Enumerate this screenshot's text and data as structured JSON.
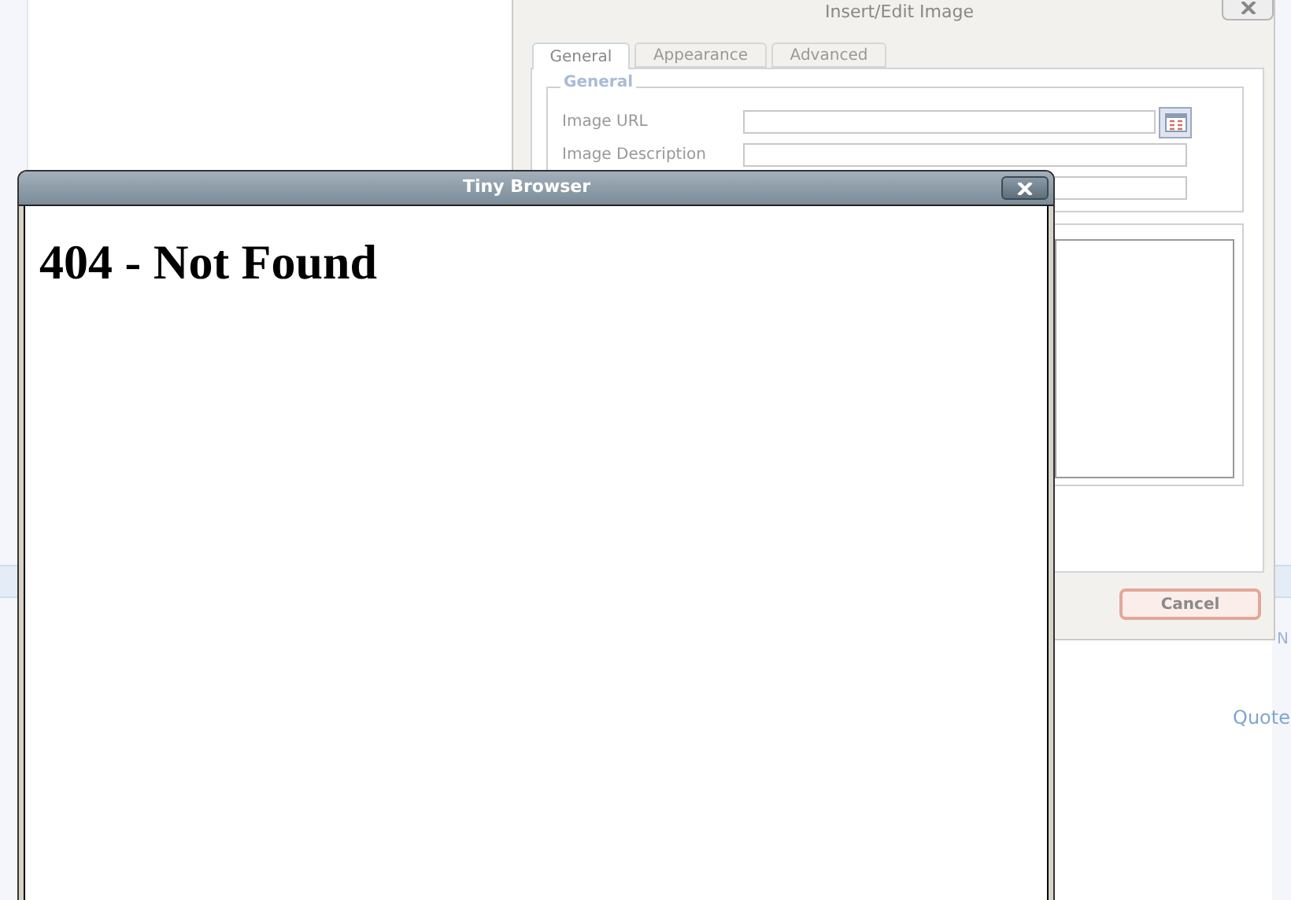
{
  "background_page": {
    "link": "Quote",
    "cut_text": "N"
  },
  "image_dialog": {
    "title": "Insert/Edit Image",
    "tabs": [
      {
        "label": "General",
        "selected": true
      },
      {
        "label": "Appearance",
        "selected": false
      },
      {
        "label": "Advanced",
        "selected": false
      }
    ],
    "fieldset": {
      "legend": "General",
      "fields": [
        {
          "label": "Image URL",
          "browse": true
        },
        {
          "label": "Image Description",
          "browse": false
        },
        {
          "browse": false
        }
      ]
    },
    "buttons": [
      "Cancel"
    ]
  },
  "browser_window": {
    "title": "Tiny Browser",
    "heading": "404 - Not Found"
  }
}
